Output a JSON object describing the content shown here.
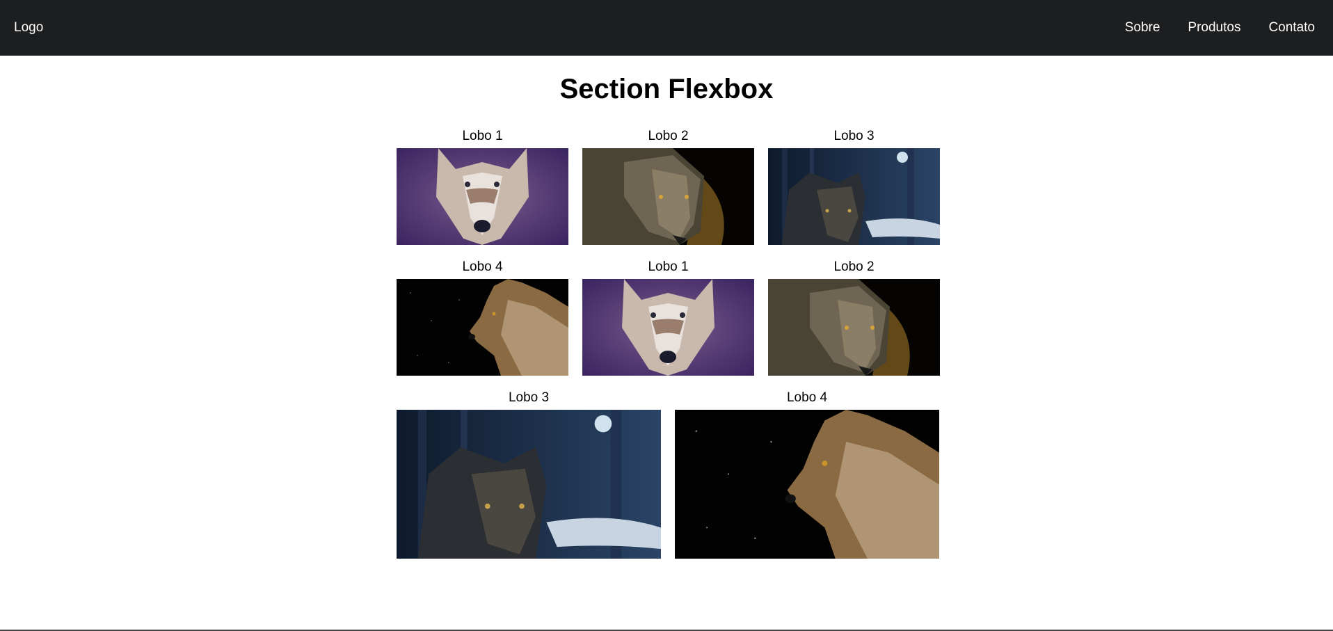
{
  "header": {
    "logo": "Logo",
    "nav": [
      "Sobre",
      "Produtos",
      "Contato"
    ],
    "background": "#1d1e20"
  },
  "main": {
    "title": "Section Flexbox",
    "rows": [
      [
        "Lobo 1",
        "Lobo 2",
        "Lobo 3"
      ],
      [
        "Lobo 4",
        "Lobo 1",
        "Lobo 2"
      ],
      [
        "Lobo 3",
        "Lobo 4"
      ]
    ]
  }
}
